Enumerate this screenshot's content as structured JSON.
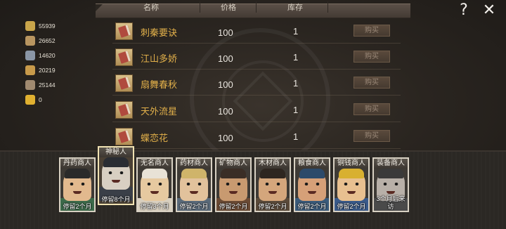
{
  "resources": [
    {
      "icon": "coin-icon",
      "value": "55939",
      "color": "#c9a54a"
    },
    {
      "icon": "wood-icon",
      "value": "26652",
      "color": "#b89560"
    },
    {
      "icon": "ore-icon",
      "value": "14620",
      "color": "#8a96a6"
    },
    {
      "icon": "grain-icon",
      "value": "20219",
      "color": "#c89a4a"
    },
    {
      "icon": "tools-icon",
      "value": "25144",
      "color": "#a08a70"
    },
    {
      "icon": "gold-badge-icon",
      "value": "0",
      "color": "#e0b030"
    }
  ],
  "table": {
    "columns": [
      "名称",
      "价格",
      "库存"
    ],
    "rows": [
      {
        "name": "刺秦要诀",
        "price": "100",
        "stock": "1",
        "action": "购买"
      },
      {
        "name": "江山多娇",
        "price": "100",
        "stock": "1",
        "action": "购买"
      },
      {
        "name": "扇舞春秋",
        "price": "100",
        "stock": "1",
        "action": "购买"
      },
      {
        "name": "天外流星",
        "price": "100",
        "stock": "1",
        "action": "购买"
      },
      {
        "name": "蝶恋花",
        "price": "100",
        "stock": "1",
        "action": "购买"
      }
    ]
  },
  "top_buttons": {
    "help": "?",
    "close": "✕"
  },
  "merchants": [
    {
      "name": "丹药商人",
      "stay": "停留2个月",
      "selected": false,
      "skin": "#e2b98e",
      "hat": "#2a2a2a",
      "body": "#3c6a4a"
    },
    {
      "name": "神秘人",
      "stay": "停留8个月",
      "selected": true,
      "skin": "#d8cfc2",
      "hat": "#2a2d33",
      "body": "#3a3f48"
    },
    {
      "name": "无名商人",
      "stay": "停留3个月",
      "selected": false,
      "skin": "#e6c9a0",
      "hat": "#e8e2d6",
      "body": "#d9d0c0"
    },
    {
      "name": "药材商人",
      "stay": "停留2个月",
      "selected": false,
      "skin": "#e2c29c",
      "hat": "#cfb46a",
      "body": "#5a6a7a"
    },
    {
      "name": "矿物商人",
      "stay": "停留2个月",
      "selected": false,
      "skin": "#c89a70",
      "hat": "#3a2e26",
      "body": "#6a4a34"
    },
    {
      "name": "木材商人",
      "stay": "停留2个月",
      "selected": false,
      "skin": "#d4a67c",
      "hat": "#2e2620",
      "body": "#5a4a3a"
    },
    {
      "name": "粮食商人",
      "stay": "停留2个月",
      "selected": false,
      "skin": "#d6a078",
      "hat": "#2c4a6a",
      "body": "#3a5a7a"
    },
    {
      "name": "铜钱商人",
      "stay": "停留2个月",
      "selected": false,
      "skin": "#e8c090",
      "hat": "#d8b030",
      "body": "#3a5a8a"
    },
    {
      "name": "装备商人",
      "stay": "3个月后来访",
      "selected": false,
      "skin": "#b8b0a8",
      "hat": "#3a3a3a",
      "body": "#4a4a4a"
    }
  ]
}
